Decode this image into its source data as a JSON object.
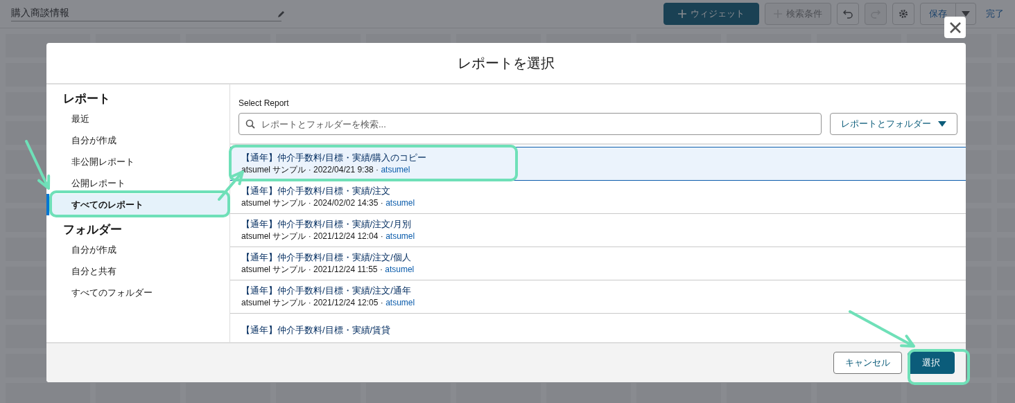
{
  "top_bar": {
    "title": "購入商談情報",
    "add_widget": {
      "label": "ウィジェット"
    },
    "add_filter": {
      "label": "検索条件",
      "disabled": true
    },
    "undo": {
      "disabled": false
    },
    "redo": {
      "disabled": true
    },
    "save": {
      "label": "保存"
    },
    "done": {
      "label": "完了"
    }
  },
  "dialog": {
    "title": "レポートを選択",
    "sidebar": [
      {
        "heading": "レポート",
        "items": [
          {
            "label": "最近",
            "selected": false
          },
          {
            "label": "自分が作成",
            "selected": false
          },
          {
            "label": "非公開レポート",
            "selected": false
          },
          {
            "label": "公開レポート",
            "selected": false
          },
          {
            "label": "すべてのレポート",
            "selected": true
          }
        ]
      },
      {
        "heading": "フォルダー",
        "items": [
          {
            "label": "自分が作成",
            "selected": false
          },
          {
            "label": "自分と共有",
            "selected": false
          },
          {
            "label": "すべてのフォルダー",
            "selected": false
          }
        ]
      }
    ],
    "search_label": "Select Report",
    "search": {
      "placeholder": "レポートとフォルダーを検索..."
    },
    "filter_dropdown": {
      "label": "レポートとフォルダー"
    },
    "reports": [
      {
        "title": "【通年】仲介手数料/目標・実績/購入のコピー",
        "meta": "atsumel サンプル · 2022/04/21 9:38 ·",
        "owner": "atsumel",
        "selected": true
      },
      {
        "title": "【通年】仲介手数料/目標・実績/注文",
        "meta": "atsumel サンプル · 2024/02/02 14:35 ·",
        "owner": "atsumel",
        "selected": false
      },
      {
        "title": "【通年】仲介手数料/目標・実績/注文/月別",
        "meta": "atsumel サンプル · 2021/12/24 12:04 ·",
        "owner": "atsumel",
        "selected": false
      },
      {
        "title": "【通年】仲介手数料/目標・実績/注文/個人",
        "meta": "atsumel サンプル · 2021/12/24 11:55 ·",
        "owner": "atsumel",
        "selected": false
      },
      {
        "title": "【通年】仲介手数料/目標・実績/注文/通年",
        "meta": "atsumel サンプル · 2021/12/24 12:05 ·",
        "owner": "atsumel",
        "selected": false
      },
      {
        "title": "【通年】仲介手数料/目標・実績/賃貸",
        "selected": false
      }
    ],
    "cancel": {
      "label": "キャンセル"
    },
    "confirm": {
      "label": "選択"
    }
  }
}
